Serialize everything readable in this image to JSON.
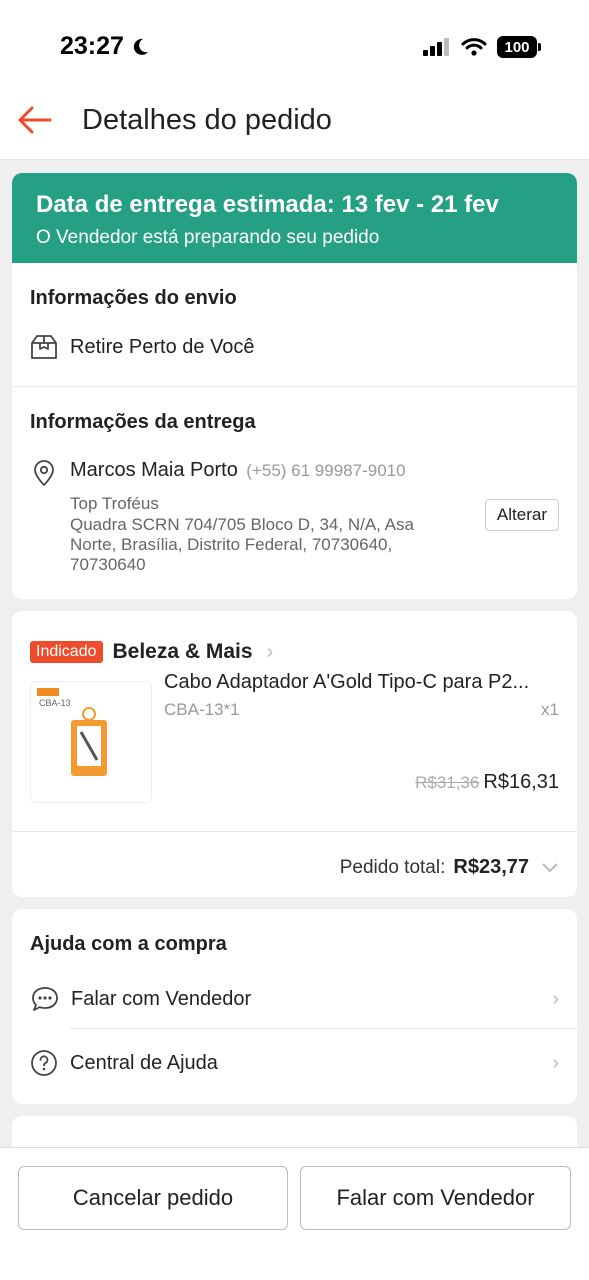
{
  "status_bar": {
    "time": "23:27",
    "battery": "100"
  },
  "header": {
    "title": "Detalhes do pedido"
  },
  "banner": {
    "title": "Data de entrega estimada: 13 fev - 21 fev",
    "subtitle": "O Vendedor está preparando seu pedido"
  },
  "shipping": {
    "title": "Informações do envio",
    "method": "Retire Perto de Você"
  },
  "delivery": {
    "title": "Informações da entrega",
    "name": "Marcos Maia Porto",
    "phone": "(+55) 61 99987-9010",
    "place": "Top Troféus",
    "address": "Quadra SCRN 704/705 Bloco D, 34, N/A, Asa Norte, Brasília, Distrito Federal, 70730640, 70730640",
    "change_label": "Alterar"
  },
  "order": {
    "badge": "Indicado",
    "shop": "Beleza & Mais",
    "product_name": "Cabo Adaptador A'Gold Tipo-C para P2...",
    "variant": "CBA-13*1",
    "quantity": "x1",
    "old_price": "R$31,36",
    "price": "R$16,31",
    "thumb_brand": "CBA-13",
    "total_label": "Pedido total:",
    "total_value": "R$23,77"
  },
  "help": {
    "title": "Ajuda com a compra",
    "items": [
      {
        "label": "Falar com Vendedor"
      },
      {
        "label": "Central de Ajuda"
      }
    ]
  },
  "bottom": {
    "cancel_label": "Cancelar pedido",
    "chat_label": "Falar com Vendedor"
  },
  "colors": {
    "accent": "#ee4d2d",
    "banner": "#26a085"
  }
}
